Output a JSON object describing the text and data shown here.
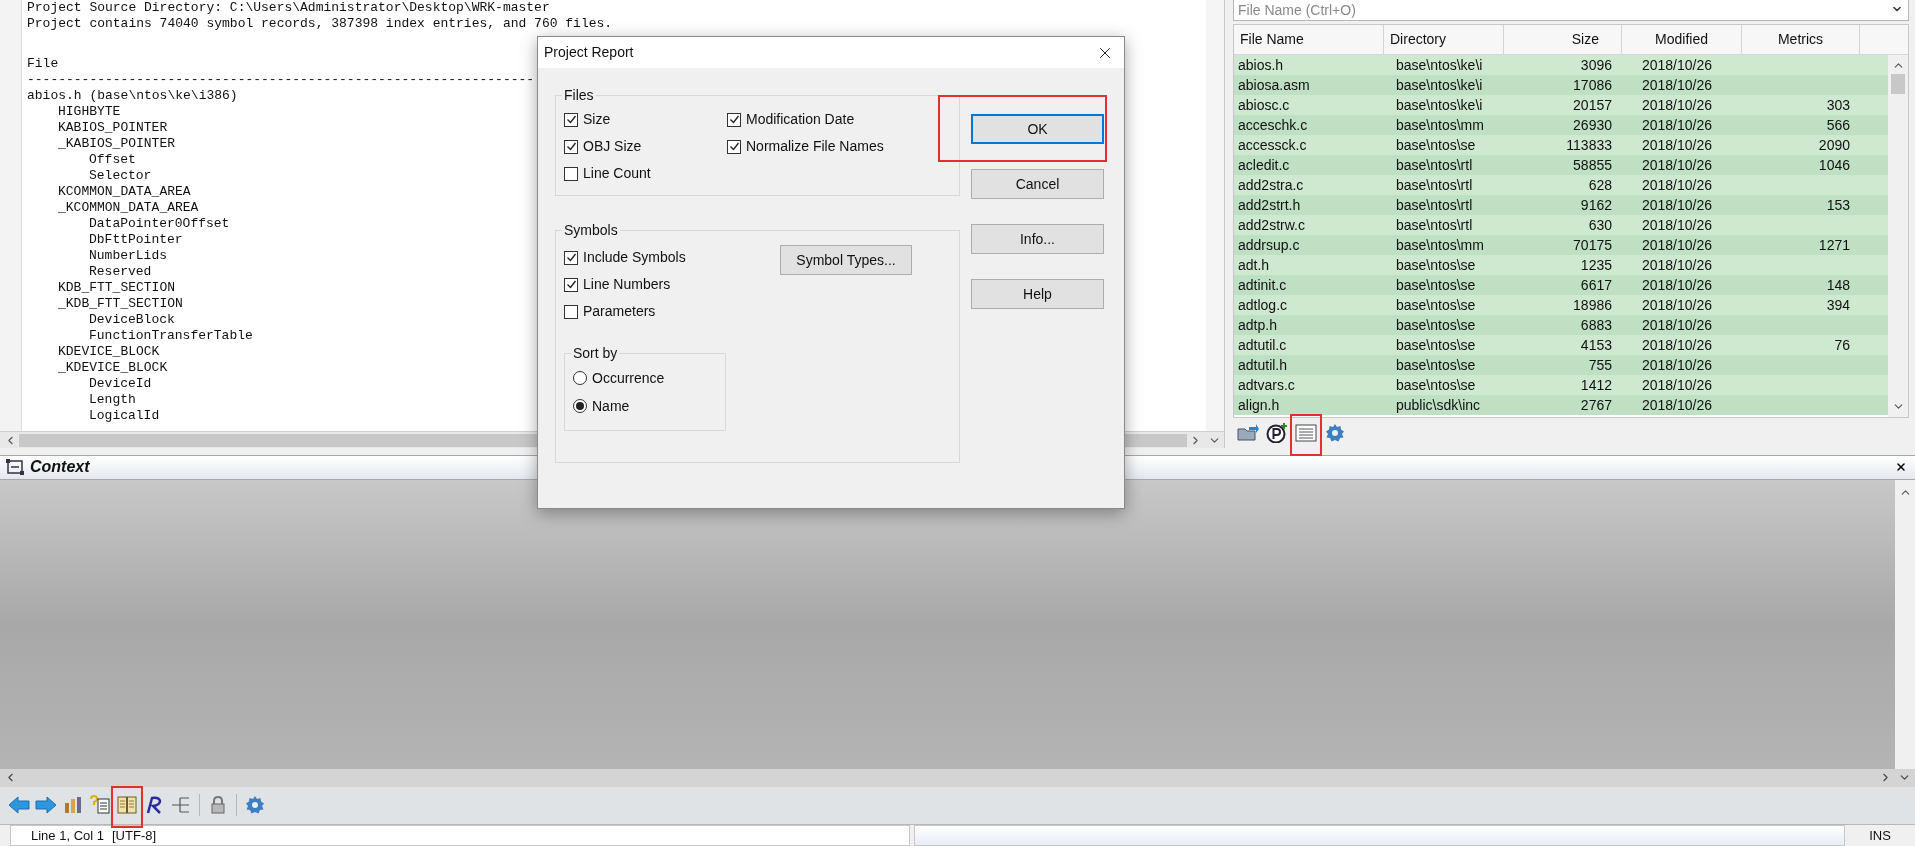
{
  "editor": {
    "header_lines": [
      "Project Source Directory: C:\\Users\\Administrator\\Desktop\\WRK-master",
      "Project contains 74040 symbol records, 387398 index entries, and 760 files."
    ],
    "section_title": "File",
    "separator": "-----------------------------------------------------------------",
    "tree": [
      {
        "text": "abios.h (base\\ntos\\ke\\i386)",
        "children": [
          {
            "text": "HIGHBYTE"
          },
          {
            "text": "KABIOS_POINTER"
          },
          {
            "text": "_KABIOS_POINTER",
            "children": [
              {
                "text": "Offset"
              },
              {
                "text": "Selector"
              }
            ]
          },
          {
            "text": "KCOMMON_DATA_AREA"
          },
          {
            "text": "_KCOMMON_DATA_AREA",
            "children": [
              {
                "text": "DataPointer0Offset"
              },
              {
                "text": "DbFttPointer"
              },
              {
                "text": "NumberLids"
              },
              {
                "text": "Reserved"
              }
            ]
          },
          {
            "text": "KDB_FTT_SECTION"
          },
          {
            "text": "_KDB_FTT_SECTION",
            "children": [
              {
                "text": "DeviceBlock"
              },
              {
                "text": "FunctionTransferTable"
              }
            ]
          },
          {
            "text": "KDEVICE_BLOCK"
          },
          {
            "text": "_KDEVICE_BLOCK",
            "children": [
              {
                "text": "DeviceId"
              },
              {
                "text": "Length"
              },
              {
                "text": "LogicalId"
              }
            ]
          }
        ]
      }
    ]
  },
  "file_panel": {
    "search": {
      "placeholder": "File Name (Ctrl+O)"
    },
    "columns": [
      "File Name",
      "Directory",
      "Size",
      "Modified",
      "Metrics"
    ],
    "rows": [
      {
        "name": "abios.h",
        "directory": "base\\ntos\\ke\\i",
        "size": "3096",
        "modified": "2018/10/26"
      },
      {
        "name": "abiosa.asm",
        "directory": "base\\ntos\\ke\\i",
        "size": "17086",
        "modified": "2018/10/26"
      },
      {
        "name": "abiosc.c",
        "directory": "base\\ntos\\ke\\i",
        "size": "20157",
        "modified": "2018/10/26",
        "metrics": "303"
      },
      {
        "name": "acceschk.c",
        "directory": "base\\ntos\\mm",
        "size": "26930",
        "modified": "2018/10/26",
        "metrics": "566"
      },
      {
        "name": "accessck.c",
        "directory": "base\\ntos\\se",
        "size": "113833",
        "modified": "2018/10/26",
        "metrics": "2090"
      },
      {
        "name": "acledit.c",
        "directory": "base\\ntos\\rtl",
        "size": "58855",
        "modified": "2018/10/26",
        "metrics": "1046"
      },
      {
        "name": "add2stra.c",
        "directory": "base\\ntos\\rtl",
        "size": "628",
        "modified": "2018/10/26"
      },
      {
        "name": "add2strt.h",
        "directory": "base\\ntos\\rtl",
        "size": "9162",
        "modified": "2018/10/26",
        "metrics": "153"
      },
      {
        "name": "add2strw.c",
        "directory": "base\\ntos\\rtl",
        "size": "630",
        "modified": "2018/10/26"
      },
      {
        "name": "addrsup.c",
        "directory": "base\\ntos\\mm",
        "size": "70175",
        "modified": "2018/10/26",
        "metrics": "1271"
      },
      {
        "name": "adt.h",
        "directory": "base\\ntos\\se",
        "size": "1235",
        "modified": "2018/10/26"
      },
      {
        "name": "adtinit.c",
        "directory": "base\\ntos\\se",
        "size": "6617",
        "modified": "2018/10/26",
        "metrics": "148"
      },
      {
        "name": "adtlog.c",
        "directory": "base\\ntos\\se",
        "size": "18986",
        "modified": "2018/10/26",
        "metrics": "394"
      },
      {
        "name": "adtp.h",
        "directory": "base\\ntos\\se",
        "size": "6883",
        "modified": "2018/10/26"
      },
      {
        "name": "adtutil.c",
        "directory": "base\\ntos\\se",
        "size": "4153",
        "modified": "2018/10/26",
        "metrics": "76"
      },
      {
        "name": "adtutil.h",
        "directory": "base\\ntos\\se",
        "size": "755",
        "modified": "2018/10/26"
      },
      {
        "name": "adtvars.c",
        "directory": "base\\ntos\\se",
        "size": "1412",
        "modified": "2018/10/26"
      },
      {
        "name": "align.h",
        "directory": "public\\sdk\\inc",
        "size": "2767",
        "modified": "2018/10/26"
      }
    ],
    "toolbar": [
      {
        "kind": "sync",
        "highlighted": false
      },
      {
        "kind": "project",
        "highlighted": false
      },
      {
        "kind": "report",
        "highlighted": true
      },
      {
        "kind": "settings",
        "highlighted": false
      }
    ]
  },
  "context_panel": {
    "title": "Context",
    "toolbar": [
      {
        "kind": "back",
        "highlighted": false
      },
      {
        "kind": "forward",
        "highlighted": false
      },
      {
        "kind": "chart",
        "highlighted": false
      },
      {
        "kind": "query",
        "highlighted": false
      },
      {
        "kind": "book",
        "highlighted": true
      },
      {
        "kind": "r",
        "highlighted": false
      },
      {
        "kind": "tree",
        "highlighted": false
      },
      {
        "kind": "separator"
      },
      {
        "kind": "lock",
        "highlighted": false
      },
      {
        "kind": "separator"
      },
      {
        "kind": "settings",
        "highlighted": false
      }
    ]
  },
  "status_bar": {
    "position": "Line 1, Col 1",
    "encoding": "[UTF-8]",
    "mode": "INS"
  },
  "dialog": {
    "title": "Project Report",
    "files_group": {
      "label": "Files",
      "options": [
        {
          "label": "Size",
          "checked": true
        },
        {
          "label": "Modification Date",
          "checked": true
        },
        {
          "label": "OBJ Size",
          "checked": true
        },
        {
          "label": "Normalize File Names",
          "checked": true
        },
        {
          "label": "Line Count",
          "checked": false
        }
      ]
    },
    "symbols_group": {
      "label": "Symbols",
      "options": [
        {
          "label": "Include Symbols",
          "checked": true
        },
        {
          "label": "Line Numbers",
          "checked": true
        },
        {
          "label": "Parameters",
          "checked": false
        }
      ],
      "button": "Symbol Types...",
      "sort": {
        "label": "Sort by",
        "options": [
          {
            "label": "Occurrence",
            "selected": false
          },
          {
            "label": "Name",
            "selected": true
          }
        ]
      }
    },
    "buttons": [
      {
        "label": "OK",
        "default": true,
        "highlighted": true
      },
      {
        "label": "Cancel",
        "default": false,
        "highlighted": false
      },
      {
        "label": "Info...",
        "default": false,
        "highlighted": false
      },
      {
        "label": "Help",
        "default": false,
        "highlighted": false
      }
    ]
  }
}
